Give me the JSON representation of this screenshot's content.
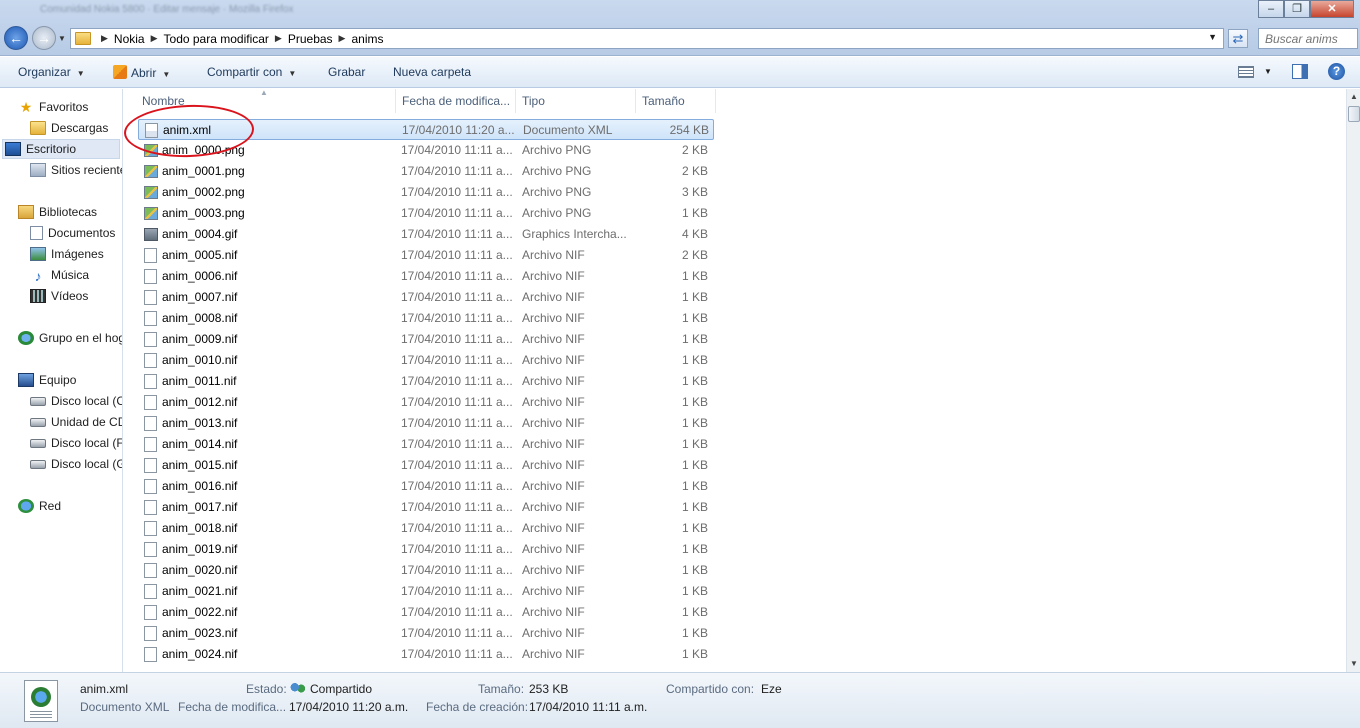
{
  "window": {
    "blurred_title": "Comunidad Nokia 5800 · Editar mensaje · Mozilla Firefox",
    "controls": [
      "minimize",
      "maximize",
      "close"
    ]
  },
  "address": {
    "breadcrumbs": [
      "Nokia",
      "Todo para modificar",
      "Pruebas",
      "anims"
    ],
    "search_placeholder": "Buscar anims"
  },
  "toolbar": {
    "organize": "Organizar",
    "open": "Abrir",
    "share": "Compartir con",
    "burn": "Grabar",
    "new_folder": "Nueva carpeta"
  },
  "nav": {
    "favorites": "Favoritos",
    "downloads": "Descargas",
    "desktop": "Escritorio",
    "recent": "Sitios reciente",
    "libraries": "Bibliotecas",
    "documents": "Documentos",
    "images": "Imágenes",
    "music": "Música",
    "videos": "Vídeos",
    "homegroup": "Grupo en el hog",
    "computer": "Equipo",
    "drive_c": "Disco local (C",
    "drive_cd": "Unidad de CD",
    "drive_f": "Disco local (F",
    "drive_g": "Disco local (G",
    "network": "Red"
  },
  "columns": {
    "name": "Nombre",
    "date": "Fecha de modifica...",
    "type": "Tipo",
    "size": "Tamaño"
  },
  "files": [
    {
      "name": "anim.xml",
      "date": "17/04/2010 11:20 a...",
      "type": "Documento XML",
      "size": "254 KB",
      "icon": "xml"
    },
    {
      "name": "anim_0000.png",
      "date": "17/04/2010 11:11 a...",
      "type": "Archivo PNG",
      "size": "2 KB",
      "icon": "png"
    },
    {
      "name": "anim_0001.png",
      "date": "17/04/2010 11:11 a...",
      "type": "Archivo PNG",
      "size": "2 KB",
      "icon": "png"
    },
    {
      "name": "anim_0002.png",
      "date": "17/04/2010 11:11 a...",
      "type": "Archivo PNG",
      "size": "3 KB",
      "icon": "png"
    },
    {
      "name": "anim_0003.png",
      "date": "17/04/2010 11:11 a...",
      "type": "Archivo PNG",
      "size": "1 KB",
      "icon": "png"
    },
    {
      "name": "anim_0004.gif",
      "date": "17/04/2010 11:11 a...",
      "type": "Graphics Intercha...",
      "size": "4 KB",
      "icon": "gif"
    },
    {
      "name": "anim_0005.nif",
      "date": "17/04/2010 11:11 a...",
      "type": "Archivo NIF",
      "size": "2 KB",
      "icon": "nif"
    },
    {
      "name": "anim_0006.nif",
      "date": "17/04/2010 11:11 a...",
      "type": "Archivo NIF",
      "size": "1 KB",
      "icon": "nif"
    },
    {
      "name": "anim_0007.nif",
      "date": "17/04/2010 11:11 a...",
      "type": "Archivo NIF",
      "size": "1 KB",
      "icon": "nif"
    },
    {
      "name": "anim_0008.nif",
      "date": "17/04/2010 11:11 a...",
      "type": "Archivo NIF",
      "size": "1 KB",
      "icon": "nif"
    },
    {
      "name": "anim_0009.nif",
      "date": "17/04/2010 11:11 a...",
      "type": "Archivo NIF",
      "size": "1 KB",
      "icon": "nif"
    },
    {
      "name": "anim_0010.nif",
      "date": "17/04/2010 11:11 a...",
      "type": "Archivo NIF",
      "size": "1 KB",
      "icon": "nif"
    },
    {
      "name": "anim_0011.nif",
      "date": "17/04/2010 11:11 a...",
      "type": "Archivo NIF",
      "size": "1 KB",
      "icon": "nif"
    },
    {
      "name": "anim_0012.nif",
      "date": "17/04/2010 11:11 a...",
      "type": "Archivo NIF",
      "size": "1 KB",
      "icon": "nif"
    },
    {
      "name": "anim_0013.nif",
      "date": "17/04/2010 11:11 a...",
      "type": "Archivo NIF",
      "size": "1 KB",
      "icon": "nif"
    },
    {
      "name": "anim_0014.nif",
      "date": "17/04/2010 11:11 a...",
      "type": "Archivo NIF",
      "size": "1 KB",
      "icon": "nif"
    },
    {
      "name": "anim_0015.nif",
      "date": "17/04/2010 11:11 a...",
      "type": "Archivo NIF",
      "size": "1 KB",
      "icon": "nif"
    },
    {
      "name": "anim_0016.nif",
      "date": "17/04/2010 11:11 a...",
      "type": "Archivo NIF",
      "size": "1 KB",
      "icon": "nif"
    },
    {
      "name": "anim_0017.nif",
      "date": "17/04/2010 11:11 a...",
      "type": "Archivo NIF",
      "size": "1 KB",
      "icon": "nif"
    },
    {
      "name": "anim_0018.nif",
      "date": "17/04/2010 11:11 a...",
      "type": "Archivo NIF",
      "size": "1 KB",
      "icon": "nif"
    },
    {
      "name": "anim_0019.nif",
      "date": "17/04/2010 11:11 a...",
      "type": "Archivo NIF",
      "size": "1 KB",
      "icon": "nif"
    },
    {
      "name": "anim_0020.nif",
      "date": "17/04/2010 11:11 a...",
      "type": "Archivo NIF",
      "size": "1 KB",
      "icon": "nif"
    },
    {
      "name": "anim_0021.nif",
      "date": "17/04/2010 11:11 a...",
      "type": "Archivo NIF",
      "size": "1 KB",
      "icon": "nif"
    },
    {
      "name": "anim_0022.nif",
      "date": "17/04/2010 11:11 a...",
      "type": "Archivo NIF",
      "size": "1 KB",
      "icon": "nif"
    },
    {
      "name": "anim_0023.nif",
      "date": "17/04/2010 11:11 a...",
      "type": "Archivo NIF",
      "size": "1 KB",
      "icon": "nif"
    },
    {
      "name": "anim_0024.nif",
      "date": "17/04/2010 11:11 a...",
      "type": "Archivo NIF",
      "size": "1 KB",
      "icon": "nif"
    }
  ],
  "details": {
    "file_name": "anim.xml",
    "file_type": "Documento XML",
    "state_label": "Estado:",
    "state_value": "Compartido",
    "size_label": "Tamaño:",
    "size_value": "253 KB",
    "shared_with_label": "Compartido con:",
    "shared_with_value": "Eze",
    "modified_label": "Fecha de modifica...",
    "modified_value": "17/04/2010 11:20 a.m.",
    "created_label": "Fecha de creación:",
    "created_value": "17/04/2010 11:11 a.m."
  },
  "colors": {
    "selection": "#cfe4fa",
    "annotation_circle": "#d9141d",
    "toolbar_text": "#1e395b"
  }
}
